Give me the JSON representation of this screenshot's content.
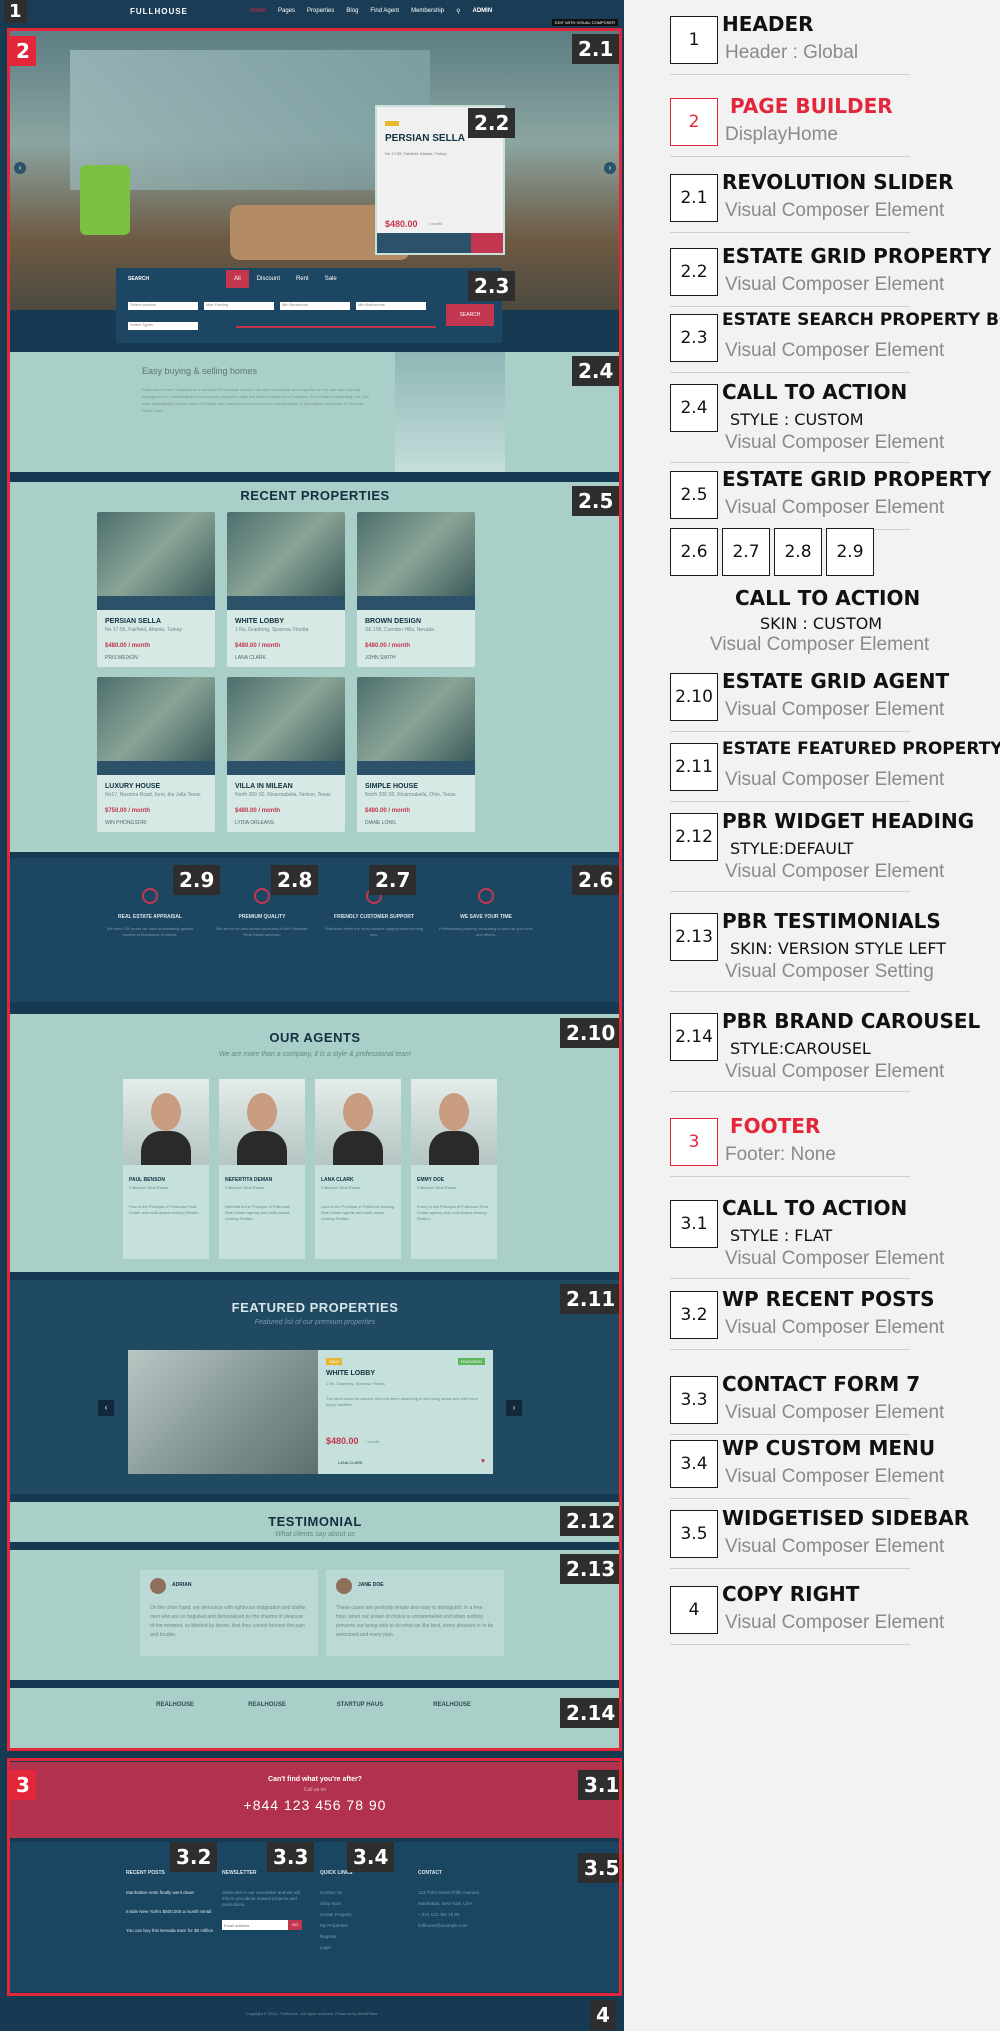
{
  "mockup": {
    "header": {
      "logo": "FULLHOUSE",
      "nav": [
        "Home",
        "Pages",
        "Properties",
        "Blog",
        "Find Agent",
        "Membership"
      ],
      "user": "ADMIN",
      "tag": "EDIT WITH VISUAL COMPOSER",
      "badge": "1"
    },
    "page_builder_badge": "2",
    "slider": {
      "badge": "2.1",
      "card_badge": "2.2",
      "property_title": "PERSIAN SELLA",
      "property_address": "No 17-55, Fairfield, Atlanta, Turkey",
      "property_price": "$480.00",
      "property_period": "/ month"
    },
    "search": {
      "badge": "2.3",
      "label": "SEARCH",
      "tabs": [
        "All",
        "Discount",
        "Rent",
        "Sale"
      ],
      "fields": [
        "Select location",
        "Max Parking",
        "Min Bedrooms",
        "Min Bathrooms"
      ],
      "type_placeholder": "Select Types",
      "button": "SEARCH"
    },
    "cta": {
      "badge": "2.4",
      "title": "Easy buying & selling homes",
      "text": "Fullhouse Homes Properties is a complete Real Estate service. We offer experience and expertise for the sale and property management in residential and commercial properties make the client experience in Fullhouse Real Estate a rewarding one. Our team strategically present offers of Resale and Leasing Homes across the municipalities of Stonington Lakeshore & Pershing South Vista."
    },
    "recent": {
      "badge": "2.5",
      "title": "RECENT PROPERTIES",
      "cards": [
        {
          "title": "PERSIAN SELLA",
          "addr": "No 17-55, Fairfield, Atlanta, Turkey",
          "price": "$480.00 / month",
          "agent": "PRIS MEIXON"
        },
        {
          "title": "WHITE LOBBY",
          "addr": "1 Rs, Granberg, Sparrow, Florida",
          "price": "$480.00 / month",
          "agent": "LANA CLARK"
        },
        {
          "title": "BROWN DESIGN",
          "addr": "SE 195, Camden Hills, Nevada",
          "price": "$480.00 / month",
          "agent": "JOHN SMITH"
        },
        {
          "title": "LUXURY HOUSE",
          "addr": "No17, Nosoma Road, Kent, the Jolla Texas",
          "price": "$750.00 / month",
          "agent": "WIN PHONGSORI"
        },
        {
          "title": "VILLA IN MILEAN",
          "addr": "North 200 S0, Rivarmabella, Nelson, Texas",
          "price": "$480.00 / month",
          "agent": "LYDIA ORLEANS"
        },
        {
          "title": "SIMPLE HOUSE",
          "addr": "North 200 S0, Rivarmabella, Ohio, Texas",
          "price": "$480.00 / month",
          "agent": "DIANE LONG"
        }
      ]
    },
    "features": {
      "badges": [
        "2.9",
        "2.8",
        "2.7",
        "2.6"
      ],
      "items": [
        {
          "title": "REAL ESTATE APPRAISAL",
          "text": "We were 100 years we have successfully guided dozens of thousands of clients."
        },
        {
          "title": "PREMIUM QUALITY",
          "text": "We aim to be well-known providers of the Fullhouse Real Estate services."
        },
        {
          "title": "FRIENDLY CUSTOMER SUPPORT",
          "text": "Fullhouse offers the most creative support team serving you."
        },
        {
          "title": "WE SAVE YOUR TIME",
          "text": "Professional property consulting to save all your time and efforts."
        }
      ]
    },
    "agents": {
      "badge": "2.10",
      "title": "OUR AGENTS",
      "subtitle": "We are more than a company, it is a style & professional team",
      "items": [
        {
          "name": "PAUL BENSON",
          "role": "Fullhouse Real Estate",
          "desc": "Paul is the Principal of Fullhouse Real Estate and multi-award winning Realtor..."
        },
        {
          "name": "NEFERTITA DEMAN",
          "role": "Fullhouse Real Estate",
          "desc": "Nefertita is the Principal of Fullhouse Real Estate agency and multi-award winning Realtor..."
        },
        {
          "name": "LANA CLARK",
          "role": "Fullhouse Real Estate",
          "desc": "Lana is the Principal of Fullhouse leading Real Estate agents and multi-award winning Realtor..."
        },
        {
          "name": "EMMY DOE",
          "role": "Fullhouse Real Estate",
          "desc": "Emmy is the Principal of Fullhouse Real Estate agency and multi-award winning Realtor..."
        }
      ]
    },
    "featured": {
      "badge": "2.11",
      "title": "FEATURED PROPERTIES",
      "subtitle": "Featured list of our premium properties",
      "property_title": "WHITE LOBBY",
      "property_addr": "1 Rs, Granberg, Sparrow, Florida",
      "property_text": "The ideal home for anyone who has been searching a new living space and with more luxury facilities.",
      "price": "$480.00",
      "period": "/ month",
      "agent": "LANA CLARK",
      "tag_sale": "SALE",
      "tag_featured": "FEATURED"
    },
    "testimonial_heading": {
      "badge": "2.12",
      "title": "TESTIMONIAL",
      "subtitle": "What clients say about us"
    },
    "testimonials": {
      "badge": "2.13",
      "items": [
        {
          "name": "ADRIAN",
          "text": "On the other hand, we denounce with righteous indignation and dislike men who are so beguiled and demoralized by the charms of pleasure of the moment, so blinded by desire, that they cannot foresee the pain and trouble."
        },
        {
          "name": "JANE DOE",
          "text": "These cases are perfectly simple and easy to distinguish. In a free hour, when our power of choice is untrammelled and when nothing prevents our being able to do what we like best, every pleasure is to be welcomed and every pain."
        }
      ]
    },
    "brands": {
      "badge": "2.14",
      "items": [
        "REALHOUSE",
        "REALHOUSE",
        "STARTUP HAUS",
        "REALHOUSE"
      ]
    },
    "footer_badge": "3",
    "footer_cta": {
      "badge": "3.1",
      "title": "Can't find what you're after?",
      "sub": "Call us on",
      "phone": "+844 123 456 78 90"
    },
    "footer": {
      "badges": [
        "3.2",
        "3.3",
        "3.4",
        "3.5"
      ],
      "recent_posts": {
        "title": "RECENT POSTS",
        "items": [
          "Manhattan rents finally went down",
          "Inside New York's $500,000 a month rental",
          "You can buy this Nevada town for $6 million"
        ]
      },
      "newsletter": {
        "title": "NEWSLETTER",
        "text": "Subscribe to our newsletter and we will inform you about newest projects and promotions.",
        "placeholder": "Email address",
        "button": "GO"
      },
      "quick_links": {
        "title": "QUICK LINKS",
        "items": [
          "Contact Us",
          "Shop Now",
          "Create Property",
          "My Properties",
          "Register",
          "Login"
        ]
      },
      "contact": {
        "title": "CONTACT",
        "lines": [
          "123 Third Street (Fifth Avenue)",
          "Manhattan, New York, USA",
          "+ 844 123 456 78 90",
          "fullhouse@example.com"
        ]
      }
    },
    "copyright": {
      "badge": "4",
      "text": "Copyright © 2016 - Fullhouse - All rights reserved. Powered by WordPress."
    }
  },
  "legend": [
    {
      "num": "1",
      "title": "HEADER",
      "subs": [
        {
          "text": "Header : Global",
          "style": "gray"
        }
      ]
    },
    {
      "num": "2",
      "title": "PAGE BUILDER",
      "red": true,
      "subs": [
        {
          "text": "DisplayHome",
          "style": "gray"
        }
      ]
    },
    {
      "num": "2.1",
      "title": "REVOLUTION SLIDER",
      "subs": [
        {
          "text": "Visual Composer Element",
          "style": "gray"
        }
      ]
    },
    {
      "num": "2.2",
      "title": "ESTATE GRID PROPERTY",
      "subs": [
        {
          "text": "Visual Composer Element",
          "style": "gray"
        }
      ]
    },
    {
      "num": "2.3",
      "title": "ESTATE SEARCH PROPERTY BOX",
      "subs": [
        {
          "text": "Visual Composer Element",
          "style": "gray"
        }
      ]
    },
    {
      "num": "2.4",
      "title": "CALL TO ACTION",
      "subs": [
        {
          "text": "STYLE : CUSTOM",
          "style": "dark"
        },
        {
          "text": "Visual Composer Element",
          "style": "gray"
        }
      ]
    },
    {
      "num": "2.5",
      "title": "ESTATE GRID PROPERTY",
      "subs": [
        {
          "text": "Visual Composer Element",
          "style": "gray"
        }
      ]
    },
    {
      "nums": [
        "2.6",
        "2.7",
        "2.8",
        "2.9"
      ],
      "title": "CALL TO ACTION",
      "subs": [
        {
          "text": "SKIN : CUSTOM",
          "style": "dark"
        },
        {
          "text": "Visual Composer Element",
          "style": "gray"
        }
      ]
    },
    {
      "num": "2.10",
      "title": "ESTATE GRID AGENT",
      "subs": [
        {
          "text": "Visual Composer Element",
          "style": "gray"
        }
      ]
    },
    {
      "num": "2.11",
      "title": "ESTATE FEATURED PROPERTY",
      "subs": [
        {
          "text": "Visual Composer Element",
          "style": "gray"
        }
      ]
    },
    {
      "num": "2.12",
      "title": "PBR WIDGET HEADING",
      "subs": [
        {
          "text": "STYLE:DEFAULT",
          "style": "dark"
        },
        {
          "text": "Visual Composer Element",
          "style": "gray"
        }
      ]
    },
    {
      "num": "2.13",
      "title": "PBR TESTIMONIALS",
      "subs": [
        {
          "text": "SKIN: VERSION STYLE LEFT",
          "style": "dark"
        },
        {
          "text": "Visual Composer Setting",
          "style": "gray"
        }
      ]
    },
    {
      "num": "2.14",
      "title": "PBR BRAND CAROUSEL",
      "subs": [
        {
          "text": "STYLE:CAROUSEL",
          "style": "dark"
        },
        {
          "text": "Visual Composer Element",
          "style": "gray"
        }
      ]
    },
    {
      "num": "3",
      "title": "FOOTER",
      "red": true,
      "subs": [
        {
          "text": "Footer: None",
          "style": "gray"
        }
      ]
    },
    {
      "num": "3.1",
      "title": "CALL TO ACTION",
      "subs": [
        {
          "text": "STYLE : FLAT",
          "style": "dark"
        },
        {
          "text": "Visual Composer Element",
          "style": "gray"
        }
      ]
    },
    {
      "num": "3.2",
      "title": "WP RECENT POSTS",
      "subs": [
        {
          "text": "Visual Composer Element",
          "style": "gray"
        }
      ]
    },
    {
      "num": "3.3",
      "title": "CONTACT FORM 7",
      "subs": [
        {
          "text": "Visual Composer Element",
          "style": "gray"
        }
      ]
    },
    {
      "num": "3.4",
      "title": "WP CUSTOM MENU",
      "subs": [
        {
          "text": "Visual Composer Element",
          "style": "gray"
        }
      ]
    },
    {
      "num": "3.5",
      "title": "WIDGETISED SIDEBAR",
      "subs": [
        {
          "text": "Visual Composer Element",
          "style": "gray"
        }
      ]
    },
    {
      "num": "4",
      "title": "COPY RIGHT",
      "subs": [
        {
          "text": "Visual Composer Element",
          "style": "gray"
        }
      ]
    }
  ]
}
